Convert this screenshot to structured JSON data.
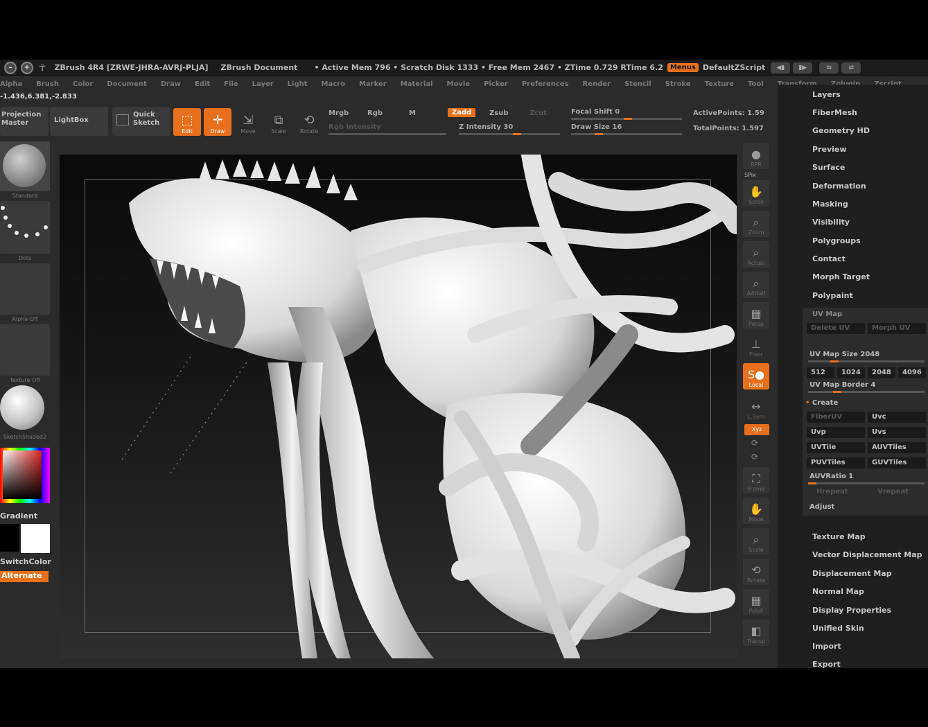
{
  "titlebar": {
    "app": "ZBrush 4R4 [ZRWE-JHRA-AVRJ-PLJA]",
    "document": "ZBrush Document",
    "stats": "• Active Mem 796 • Scratch Disk 1333 • Free Mem 2467 • ZTime 0.729 RTime 6.2",
    "menus_btn": "Menus",
    "script": "DefaultZScript"
  },
  "menubar": [
    "Alpha",
    "Brush",
    "Color",
    "Document",
    "Draw",
    "Edit",
    "File",
    "Layer",
    "Light",
    "Macro",
    "Marker",
    "Material",
    "Movie",
    "Picker",
    "Preferences",
    "Render",
    "Stencil",
    "Stroke",
    "Texture",
    "Tool",
    "Transform",
    "Zplugin",
    "Zscript"
  ],
  "coords": "-1.436,6.381,-2.833",
  "shelf": {
    "projection_master": "Projection Master",
    "lightbox": "LightBox",
    "quick_sketch": "Quick Sketch",
    "edit": "Edit",
    "draw": "Draw",
    "move": "Move",
    "scale": "Scale",
    "rotate": "Rotate",
    "mrgb": "Mrgb",
    "rgb": "Rgb",
    "m": "M",
    "rgb_intensity": "Rgb Intensity",
    "zadd": "Zadd",
    "zsub": "Zsub",
    "zcut": "Zcut",
    "z_intensity": "Z Intensity 30",
    "focal_shift": "Focal Shift 0",
    "draw_size": "Draw Size 16",
    "active_points": "ActivePoints: 1.59",
    "total_points": "TotalPoints: 1.597"
  },
  "left_panel": {
    "brush": "Standard",
    "stroke": "Dots",
    "alpha": "Alpha Off",
    "texture": "Texture Off",
    "material": "SketchShaded2",
    "gradient": "Gradient",
    "switch_color": "SwitchColor",
    "alternate": "Alternate"
  },
  "dock": [
    "BPR",
    "SPix",
    "Scroll",
    "Zoom",
    "Actual",
    "AAHalf",
    "Persp",
    "Floor",
    "Local",
    "L.Sym",
    "Xyz",
    "Frame",
    "Move",
    "Scale",
    "Rotate",
    "PolyF",
    "Transp"
  ],
  "palette": {
    "items_top": [
      "Layers",
      "FiberMesh",
      "Geometry HD",
      "Preview",
      "Surface",
      "Deformation",
      "Masking",
      "Visibility",
      "Polygroups",
      "Contact",
      "Morph Target",
      "Polypaint"
    ],
    "uv_map": {
      "title": "UV Map",
      "delete_uv": "Delete UV",
      "morph_uv": "Morph UV",
      "size_label": "UV Map Size 2048",
      "sizes": [
        "512",
        "1024",
        "2048",
        "4096"
      ],
      "border_label": "UV Map Border 4",
      "create": "Create",
      "fiberuv": "FiberUV",
      "uvc": "Uvc",
      "uvp": "Uvp",
      "uvs": "Uvs",
      "uvtile": "UVTile",
      "auvtiles": "AUVTiles",
      "puvtiles": "PUVTiles",
      "guvtiles": "GUVTiles",
      "auvratio": "AUVRatio 1",
      "hrepeat": "Hrepeat",
      "vrepeat": "Vrepeat",
      "adjust": "Adjust"
    },
    "items_bottom": [
      "Texture Map",
      "Vector Displacement Map",
      "Displacement Map",
      "Normal Map",
      "Display Properties",
      "Unified Skin",
      "Import",
      "Export"
    ]
  },
  "colors": {
    "accent": "#e8701c",
    "panel": "#2b2b2b",
    "dark": "#1f1f1f"
  }
}
